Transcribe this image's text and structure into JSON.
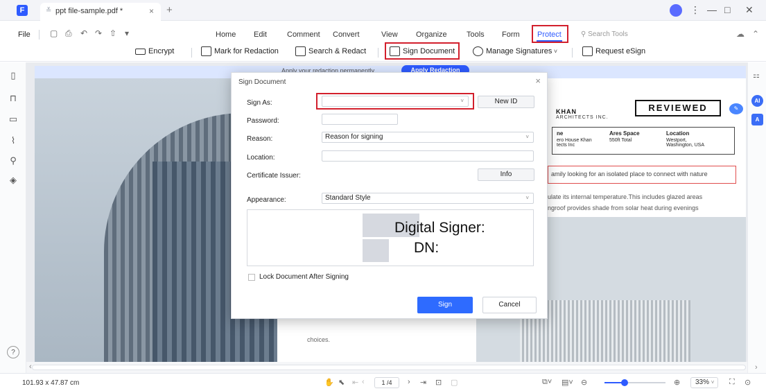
{
  "window": {
    "tab_title": "ppt file-sample.pdf *",
    "tab_close": "×",
    "tab_add": "+",
    "controls": [
      "⋮",
      "—",
      "□",
      "✕"
    ]
  },
  "menu": {
    "file": "File",
    "tabs": [
      "Home",
      "Edit",
      "Comment",
      "Convert",
      "View",
      "Organize",
      "Tools",
      "Form",
      "Protect"
    ],
    "active_tab": "Protect",
    "search_tools": "Search Tools"
  },
  "toolbar": {
    "encrypt": "Encrypt",
    "mark_for_redaction": "Mark for Redaction",
    "search_redact": "Search & Redact",
    "sign_document": "Sign Document",
    "manage_signatures": "Manage Signatures",
    "request_esign": "Request eSign"
  },
  "banner": {
    "text": "Apply your redaction permanently",
    "button": "Apply Redaction"
  },
  "document": {
    "arch_name": "KHAN",
    "arch_sub": "ARCHITECTS INC.",
    "reviewed_stamp": "REVIEWED",
    "info_cols": [
      {
        "head": "ne",
        "value": "ero House Khan\ntects Inc"
      },
      {
        "head": "Ares Space",
        "value": "550ft Total"
      },
      {
        "head": "Location",
        "value": "Westport,\nWashington, USA"
      }
    ],
    "quote": "amily looking for an isolated place to connect with nature",
    "body_lines": [
      "ulate its internal temperature.This includes glazed areas",
      "ngroof provides shade from solar heat during evenings"
    ],
    "choices": "choices."
  },
  "dialog": {
    "title": "Sign Document",
    "close": "×",
    "sign_as_label": "Sign As:",
    "sign_as_value": "",
    "new_id": "New ID",
    "password_label": "Password:",
    "password_value": "",
    "reason_label": "Reason:",
    "reason_value": "Reason for signing",
    "location_label": "Location:",
    "location_value": "",
    "cert_issuer_label": "Certificate Issuer:",
    "info_button": "Info",
    "appearance_label": "Appearance:",
    "appearance_value": "Standard Style",
    "preview_line1": "Digital Signer:",
    "preview_line2": "DN:",
    "lock_label": "Lock Document After Signing",
    "lock_checked": false,
    "sign_button": "Sign",
    "cancel_button": "Cancel"
  },
  "statusbar": {
    "dimensions": "101.93 x 47.87 cm",
    "page": "1 /4",
    "zoom": "33%",
    "zoom_level": 0.33
  },
  "colors": {
    "accent": "#2e5bff",
    "highlight_red": "#d21f2c"
  }
}
